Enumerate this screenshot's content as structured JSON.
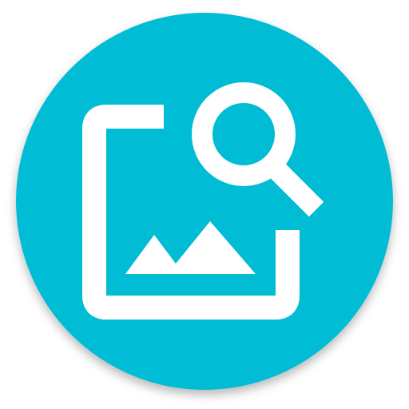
{
  "icon": {
    "name": "image-search-app-icon",
    "colors": {
      "background": "#00bcd4",
      "glyph": "#ffffff"
    },
    "parts": [
      "image-frame-icon",
      "mountain-icon",
      "magnifier-icon"
    ]
  }
}
